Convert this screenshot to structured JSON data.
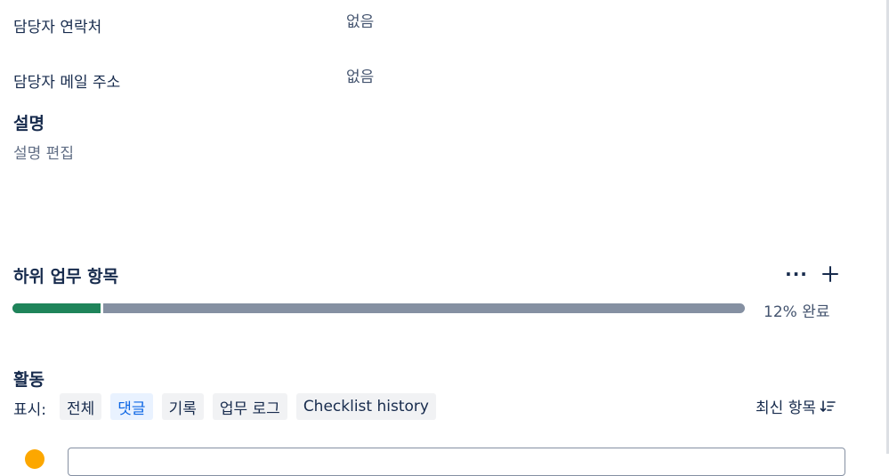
{
  "fields": {
    "contact": {
      "label": "담당자 연락처",
      "value": "없음"
    },
    "email": {
      "label": "담당자 메일 주소",
      "value": "없음"
    }
  },
  "description": {
    "title": "설명",
    "placeholder": "설명 편집"
  },
  "subtasks": {
    "title": "하위 업무 항목",
    "more_icon": "more-horizontal-icon",
    "add_icon": "plus-icon",
    "progress_percent": 12,
    "progress_text": "12% 완료",
    "colors": {
      "done": "#1f845a",
      "remaining": "#8590a2"
    }
  },
  "activity": {
    "title": "활동",
    "show_label": "표시:",
    "filters": [
      {
        "label": "전체",
        "selected": false
      },
      {
        "label": "댓글",
        "selected": true
      },
      {
        "label": "기록",
        "selected": false
      },
      {
        "label": "업무 로그",
        "selected": false
      },
      {
        "label": "Checklist history",
        "selected": false
      }
    ],
    "sort_label": "최신 항목",
    "sort_icon": "sort-descending-icon"
  }
}
